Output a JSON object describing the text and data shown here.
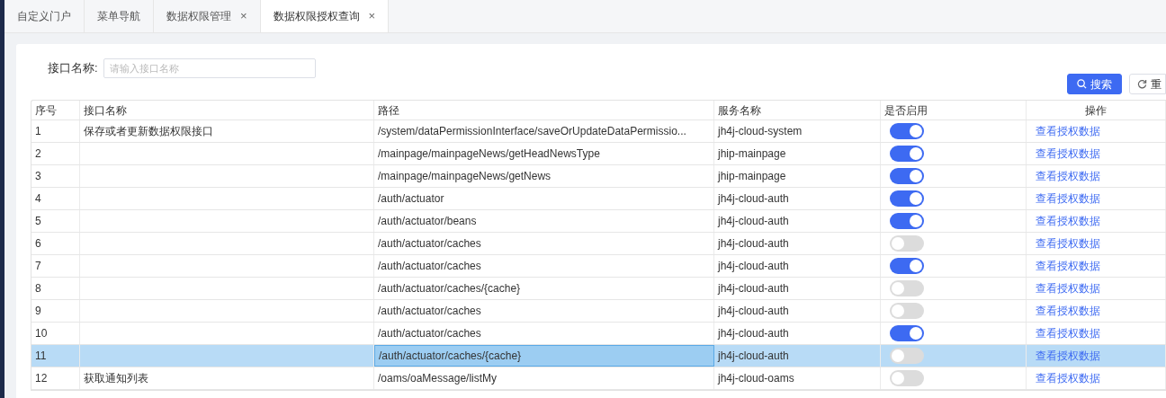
{
  "tabs": [
    {
      "label": "自定义门户",
      "selected": false
    },
    {
      "label": "菜单导航",
      "selected": false
    },
    {
      "label": "数据权限管理",
      "close": "×",
      "selected": false
    },
    {
      "label": "数据权限授权查询",
      "close": "×",
      "selected": true
    }
  ],
  "filter": {
    "label": "接口名称:",
    "placeholder": "请输入接口名称"
  },
  "buttons": [
    {
      "kind": "primary",
      "label": "搜索"
    },
    {
      "kind": "reset",
      "label": "重"
    }
  ],
  "table": {
    "columns": [
      "序号",
      "接口名称",
      "路径",
      "服务名称",
      "是否启用",
      "操作"
    ],
    "rows": [
      {
        "no": "1",
        "name": "保存或者更新数据权限接口",
        "path": "/system/dataPermissionInterface/saveOrUpdateDataPermissio...",
        "service": "jh4j-cloud-system",
        "on": true,
        "action": "查看授权数据",
        "selected": false
      },
      {
        "no": "2",
        "path": "/mainpage/mainpageNews/getHeadNewsType",
        "service": "jhip-mainpage",
        "on": true,
        "action": "查看授权数据",
        "selected": false
      },
      {
        "no": "3",
        "path": "/mainpage/mainpageNews/getNews",
        "service": "jhip-mainpage",
        "on": true,
        "action": "查看授权数据",
        "selected": false
      },
      {
        "no": "4",
        "path": "/auth/actuator",
        "service": "jh4j-cloud-auth",
        "on": true,
        "action": "查看授权数据",
        "selected": false
      },
      {
        "no": "5",
        "path": "/auth/actuator/beans",
        "service": "jh4j-cloud-auth",
        "on": true,
        "action": "查看授权数据",
        "selected": false
      },
      {
        "no": "6",
        "path": "/auth/actuator/caches",
        "service": "jh4j-cloud-auth",
        "on": false,
        "action": "查看授权数据",
        "selected": false
      },
      {
        "no": "7",
        "path": "/auth/actuator/caches",
        "service": "jh4j-cloud-auth",
        "on": true,
        "action": "查看授权数据",
        "selected": false
      },
      {
        "no": "8",
        "path": "/auth/actuator/caches/{cache}",
        "service": "jh4j-cloud-auth",
        "on": false,
        "action": "查看授权数据",
        "selected": false
      },
      {
        "no": "9",
        "path": "/auth/actuator/caches",
        "service": "jh4j-cloud-auth",
        "on": false,
        "action": "查看授权数据",
        "selected": false
      },
      {
        "no": "10",
        "path": "/auth/actuator/caches",
        "service": "jh4j-cloud-auth",
        "on": true,
        "action": "查看授权数据",
        "selected": false
      },
      {
        "no": "11",
        "path": "/auth/actuator/caches/{cache}",
        "service": "jh4j-cloud-auth",
        "on": false,
        "action": "查看授权数据",
        "selected": true
      },
      {
        "no": "12",
        "name": "获取通知列表",
        "path": "/oams/oaMessage/listMy",
        "service": "jh4j-cloud-oams",
        "on": false,
        "action": "查看授权数据",
        "selected": false
      }
    ]
  }
}
